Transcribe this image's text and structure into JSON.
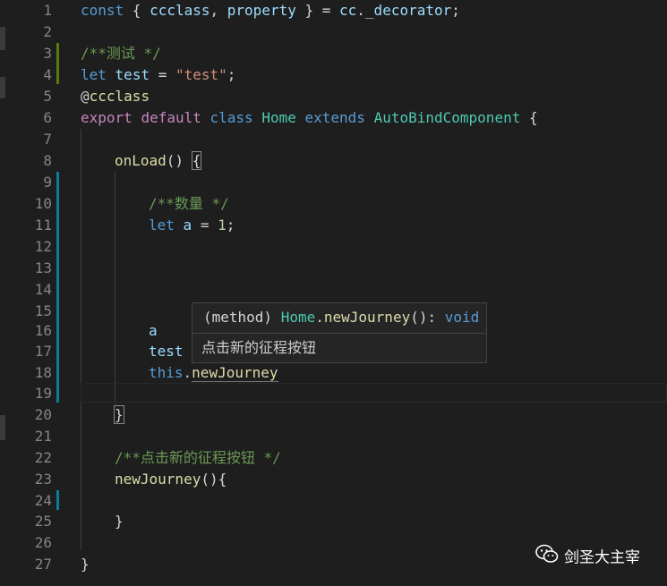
{
  "line_numbers": [
    "1",
    "2",
    "3",
    "4",
    "5",
    "6",
    "7",
    "8",
    "9",
    "10",
    "11",
    "12",
    "13",
    "14",
    "15",
    "16",
    "17",
    "18",
    "19",
    "20",
    "21",
    "22",
    "23",
    "24",
    "25",
    "26",
    "27"
  ],
  "code": {
    "l1": {
      "a": "const",
      "b": " { ",
      "c": "ccclass",
      "d": ", ",
      "e": "property",
      "f": " } = ",
      "g": "cc",
      "h": ".",
      "i": "_decorator",
      "j": ";"
    },
    "l3": {
      "a": "/**测试 */"
    },
    "l4": {
      "a": "let",
      "b": " ",
      "c": "test",
      "d": " = ",
      "e": "\"test\"",
      "f": ";"
    },
    "l5": {
      "a": "@",
      "b": "ccclass"
    },
    "l6": {
      "a": "export",
      "b": " ",
      "c": "default",
      "d": " ",
      "e": "class",
      "f": " ",
      "g": "Home",
      "h": " ",
      "i": "extends",
      "j": " ",
      "k": "AutoBindComponent",
      "l": " {"
    },
    "l8": {
      "a": "onLoad",
      "b": "() ",
      "c": "{"
    },
    "l10": {
      "a": "/**数量 */"
    },
    "l11": {
      "a": "let",
      "b": " ",
      "c": "a",
      "d": " = ",
      "e": "1",
      "f": ";"
    },
    "l16": {
      "a": "a"
    },
    "l17": {
      "a": "test"
    },
    "l18": {
      "a": "this",
      "b": ".",
      "c": "newJourney"
    },
    "l20": {
      "a": "}"
    },
    "l22": {
      "a": "/**点击新的征程按钮 */"
    },
    "l23": {
      "a": "newJourney",
      "b": "(){"
    },
    "l25": {
      "a": "}"
    },
    "l27": {
      "a": "}"
    }
  },
  "hover": {
    "kind": "(method)",
    "cls": "Home",
    "dot": ".",
    "method": "newJourney",
    "sig_rest": "(): ",
    "ret": "void",
    "doc": "点击新的征程按钮"
  },
  "watermark": {
    "text": "剑圣大主宰"
  }
}
